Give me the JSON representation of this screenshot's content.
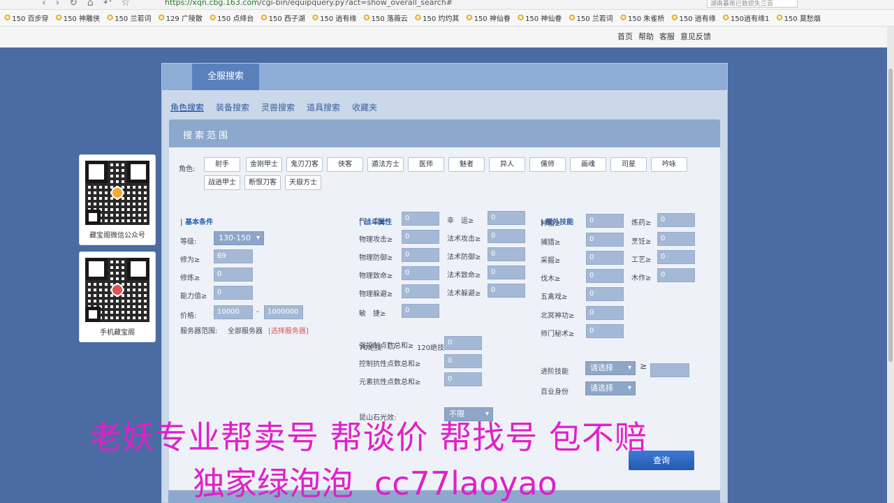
{
  "browser": {
    "url_host": "https://xqn.cbg.163.com",
    "url_path": "/cgi-bin/equipquery.py?act=show_overall_search#",
    "right_tip": "湖南暴雨已致损失三百",
    "bookmarks": [
      "150 百步穿",
      "150 神雕侠",
      "150 兰若词",
      "129 广陵散",
      "150 点绛台",
      "150 西子湖",
      "150 逍有缘",
      "150 落薇云",
      "150 灼灼其",
      "150 神仙眷",
      "150 神仙眷",
      "150 兰若词",
      "150 朱雀桥",
      "150 逍有缘",
      "150逍有缘1",
      "150 莫愁烟"
    ]
  },
  "site_nav": [
    "首页",
    "帮助",
    "客服",
    "意见反馈"
  ],
  "qr_cards": [
    {
      "label": "藏宝阁微信公众号"
    },
    {
      "label": "手机藏宝阁"
    }
  ],
  "panel": {
    "active_tab": "全服搜索",
    "subtabs": [
      "角色搜索",
      "装备搜索",
      "灵兽搜索",
      "道具搜索",
      "收藏夹"
    ],
    "range_title": "搜索范围",
    "role_label": "角色:",
    "roles": [
      "射手",
      "金刚甲士",
      "鬼刃刀客",
      "侠客",
      "遁法方士",
      "医师",
      "魅者",
      "异人",
      "儒师",
      "画魂",
      "司星",
      "吟咏",
      "战逍甲士",
      "断恨刀客",
      "天嶽方士"
    ]
  },
  "basic": {
    "title": "| 基本条件",
    "level_label": "等级:",
    "level_value": "130-150",
    "xiuwei_label": "修为≥",
    "xiuwei_value": "69",
    "xiulian_label": "修炼≥",
    "xiulian_value": "0",
    "ability_label": "能力值≥",
    "ability_value": "0",
    "price_label": "价格:",
    "price_min": "10000",
    "price_dash": "-",
    "price_max": "1000000",
    "server_label": "服务器范围:",
    "server_value": "全部服务器",
    "server_link": "[选择服务器]"
  },
  "battle": {
    "title": "| 战斗属性",
    "left": [
      {
        "label": "气　血≥",
        "value": "0"
      },
      {
        "label": "物理攻击≥",
        "value": "0"
      },
      {
        "label": "物理防御≥",
        "value": "0"
      },
      {
        "label": "物理致命≥",
        "value": "0"
      },
      {
        "label": "物理躲避≥",
        "value": "0"
      },
      {
        "label": "敏　捷≥",
        "value": "0"
      }
    ],
    "right": [
      {
        "label": "幸　运≥",
        "value": "0"
      },
      {
        "label": "法术攻击≥",
        "value": "0"
      },
      {
        "label": "法术防御≥",
        "value": "0"
      },
      {
        "label": "法术致命≥",
        "value": "0"
      },
      {
        "label": "法术躲避≥",
        "value": "0"
      }
    ],
    "check70": "70绝技",
    "check120": "120绝技",
    "extra": [
      {
        "label": "强控制点数总和≥",
        "value": "0"
      },
      {
        "label": "控制抗性点数总和≥",
        "value": "0"
      },
      {
        "label": "元素抗性点数总和≥",
        "value": "0"
      }
    ],
    "stone_label": "昆山石光效:",
    "stone_value": "不限"
  },
  "extra_skills": {
    "title": "| 额外技能",
    "left": [
      {
        "label": "种植≥",
        "value": "0"
      },
      {
        "label": "捕猎≥",
        "value": "0"
      },
      {
        "label": "采掘≥",
        "value": "0"
      },
      {
        "label": "伐木≥",
        "value": "0"
      },
      {
        "label": "五禽戏≥",
        "value": "0"
      },
      {
        "label": "北冥神功≥",
        "value": "0"
      },
      {
        "label": "师门秘术≥",
        "value": "0"
      }
    ],
    "right": [
      {
        "label": "炼药≥",
        "value": "0"
      },
      {
        "label": "烹饪≥",
        "value": "0"
      },
      {
        "label": "工艺≥",
        "value": "0"
      },
      {
        "label": "木作≥",
        "value": "0"
      }
    ],
    "advanced_label": "进阶技能",
    "advanced_value": "请选择",
    "advanced_ge": "≥",
    "identity_label": "百业身份",
    "identity_value": "请选择"
  },
  "search_button": "查询",
  "overlay": {
    "line1": "老妖专业帮卖号 帮谈价 帮找号 包不赔",
    "line2": "独家绿泡泡",
    "line2_latin": "cc77laoyao"
  },
  "colors": {
    "page_bg": "#4a6ca3",
    "tab_active": "#5b81bd",
    "overlay_text": "#e020c8",
    "accent_link": "#2a5fb0"
  }
}
